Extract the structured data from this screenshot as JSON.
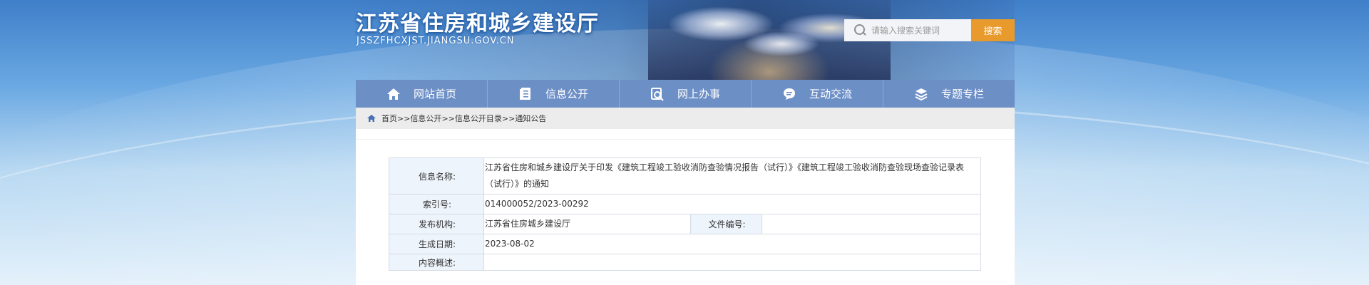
{
  "header": {
    "title": "江苏省住房和城乡建设厅",
    "domain": "JSSZFHCXJST.JIANGSU.GOV.CN"
  },
  "search": {
    "placeholder": "请输入搜索关键词",
    "button_label": "搜索",
    "icon": "search-icon"
  },
  "nav": {
    "items": [
      {
        "label": "网站首页",
        "icon": "home-icon"
      },
      {
        "label": "信息公开",
        "icon": "book-icon"
      },
      {
        "label": "网上办事",
        "icon": "search-doc-icon"
      },
      {
        "label": "互动交流",
        "icon": "chat-icon"
      },
      {
        "label": "专题专栏",
        "icon": "layers-icon"
      }
    ]
  },
  "breadcrumb": {
    "icon": "home-icon",
    "items": [
      "首页",
      "信息公开",
      "信息公开目录",
      "通知公告"
    ],
    "separator": ">>"
  },
  "info_table": {
    "name_label": "信息名称:",
    "name_value": "江苏省住房和城乡建设厅关于印发《建筑工程竣工验收消防查验情况报告（试行）》《建筑工程竣工验收消防查验现场查验记录表（试行）》的通知",
    "index_label": "索引号:",
    "index_value": "014000052/2023-00292",
    "publisher_label": "发布机构:",
    "publisher_value": "江苏省住房城乡建设厅",
    "doc_no_label": "文件编号:",
    "doc_no_value": "",
    "date_label": "生成日期:",
    "date_value": "2023-08-02",
    "summary_label": "内容概述:",
    "summary_value": ""
  },
  "colors": {
    "nav_bg": "#6c8fc6",
    "search_button": "#e89a2c",
    "label_bg": "#eef4fb",
    "crumb_bg": "#ececec"
  }
}
